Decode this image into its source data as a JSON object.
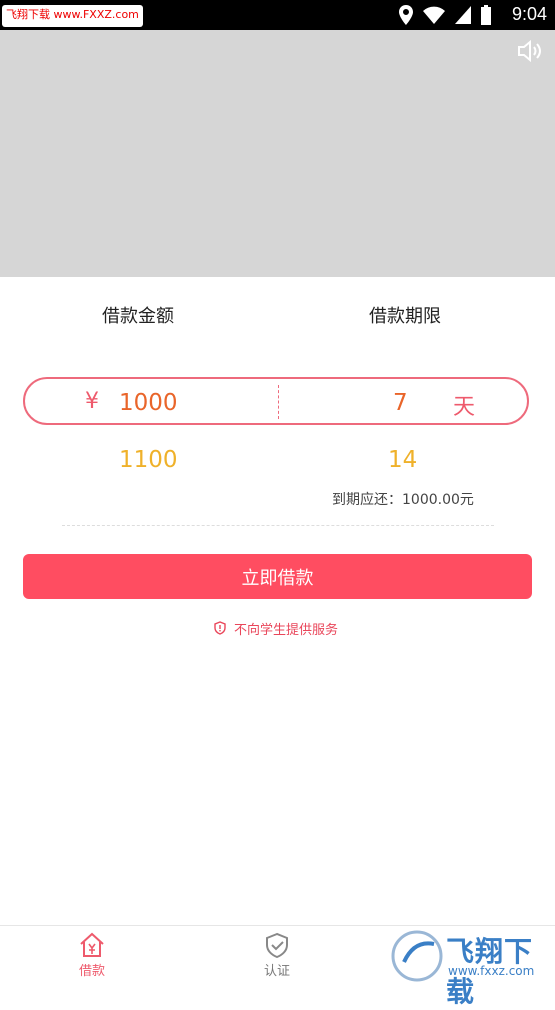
{
  "status_bar": {
    "watermark": "飞翔下载 www.FXXZ.com",
    "time": "9:04",
    "icons": [
      "location-icon",
      "wifi-icon",
      "signal-icon",
      "battery-icon"
    ]
  },
  "banner": {
    "volume_icon": "volume-icon"
  },
  "loan": {
    "amount_label": "借款金额",
    "term_label": "借款期限",
    "currency_symbol": "¥",
    "amount_selected": "1000",
    "amount_alt": "1100",
    "term_selected": "7",
    "term_unit": "天",
    "term_alt": "14",
    "due_text": "到期应还：1000.00元"
  },
  "action": {
    "borrow_label": "立即借款"
  },
  "notice": {
    "text": "不向学生提供服务",
    "icon": "shield-icon"
  },
  "tabs": [
    {
      "label": "借款",
      "icon": "home-yen-icon",
      "active": true
    },
    {
      "label": "认证",
      "icon": "shield-check-icon",
      "active": false
    }
  ],
  "watermark_bottom": {
    "title": "飞翔下载",
    "url": "www.fxxz.com"
  },
  "colors": {
    "accent": "#ff4d61",
    "option": "#efb12a",
    "value": "#e9652a"
  }
}
